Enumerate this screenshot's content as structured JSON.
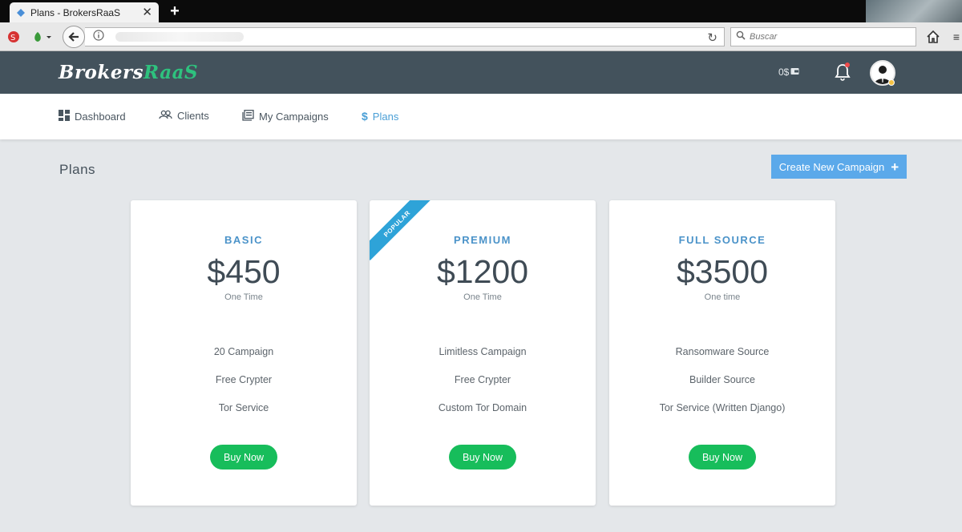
{
  "browser": {
    "tab_title": "Plans - BrokersRaaS",
    "tab_close": "✕",
    "new_tab": "+",
    "search_placeholder": "Buscar"
  },
  "header": {
    "logo_part1": "Brokers",
    "logo_part2": "RaaS",
    "balance": "0$"
  },
  "nav": {
    "items": [
      {
        "label": "Dashboard",
        "icon": "dashboard-icon"
      },
      {
        "label": "Clients",
        "icon": "users-icon"
      },
      {
        "label": "My Campaigns",
        "icon": "campaigns-icon"
      },
      {
        "label": "Plans",
        "icon": "dollar-icon",
        "active": true
      }
    ]
  },
  "page": {
    "title": "Plans",
    "create_button": "Create New Campaign",
    "create_button_icon": "+"
  },
  "plans": [
    {
      "name": "BASIC",
      "price": "$450",
      "period": "One Time",
      "features": [
        "20 Campaign",
        "Free Crypter",
        "Tor Service"
      ],
      "button": "Buy Now"
    },
    {
      "name": "PREMIUM",
      "price": "$1200",
      "period": "One Time",
      "ribbon": "POPULAR",
      "features": [
        "Limitless Campaign",
        "Free Crypter",
        "Custom Tor Domain"
      ],
      "button": "Buy Now"
    },
    {
      "name": "FULL SOURCE",
      "price": "$3500",
      "period": "One time",
      "features": [
        "Ransomware Source",
        "Builder Source",
        "Tor Service (Written Django)"
      ],
      "button": "Buy Now"
    }
  ],
  "colors": {
    "header_bg": "#43525c",
    "accent_blue": "#4a9fd6",
    "logo_green": "#2ec27e",
    "buy_green": "#17bd5b",
    "create_button": "#5ba9ea",
    "ribbon": "#2ea3d8"
  }
}
